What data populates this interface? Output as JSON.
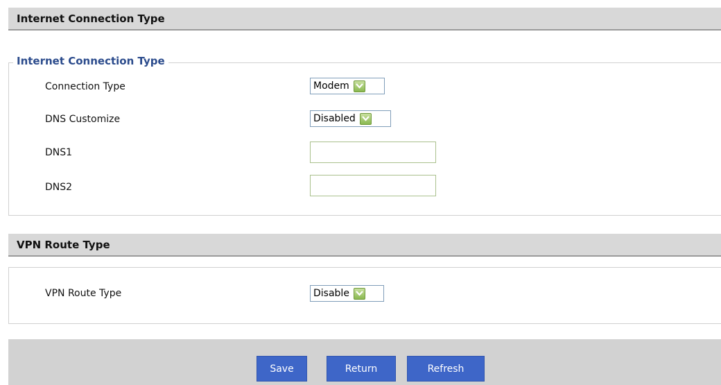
{
  "header_internet": "Internet Connection Type",
  "internet_group": {
    "legend": "Internet Connection Type",
    "connection_type": {
      "label": "Connection Type",
      "value": "Modem"
    },
    "dns_customize": {
      "label": "DNS Customize",
      "value": "Disabled"
    },
    "dns1": {
      "label": "DNS1",
      "value": ""
    },
    "dns2": {
      "label": "DNS2",
      "value": ""
    }
  },
  "header_vpn": "VPN Route Type",
  "vpn_group": {
    "route_type": {
      "label": "VPN Route Type",
      "value": "Disable"
    }
  },
  "buttons": {
    "save": "Save",
    "return": "Return",
    "refresh": "Refresh"
  },
  "colors": {
    "accent": "#3e66c8",
    "legend": "#2b4b8c",
    "header_bg": "#d8d8d8",
    "dropdown_green": "#8ab850"
  },
  "icons": {
    "dropdown": "chevron-down-icon"
  }
}
